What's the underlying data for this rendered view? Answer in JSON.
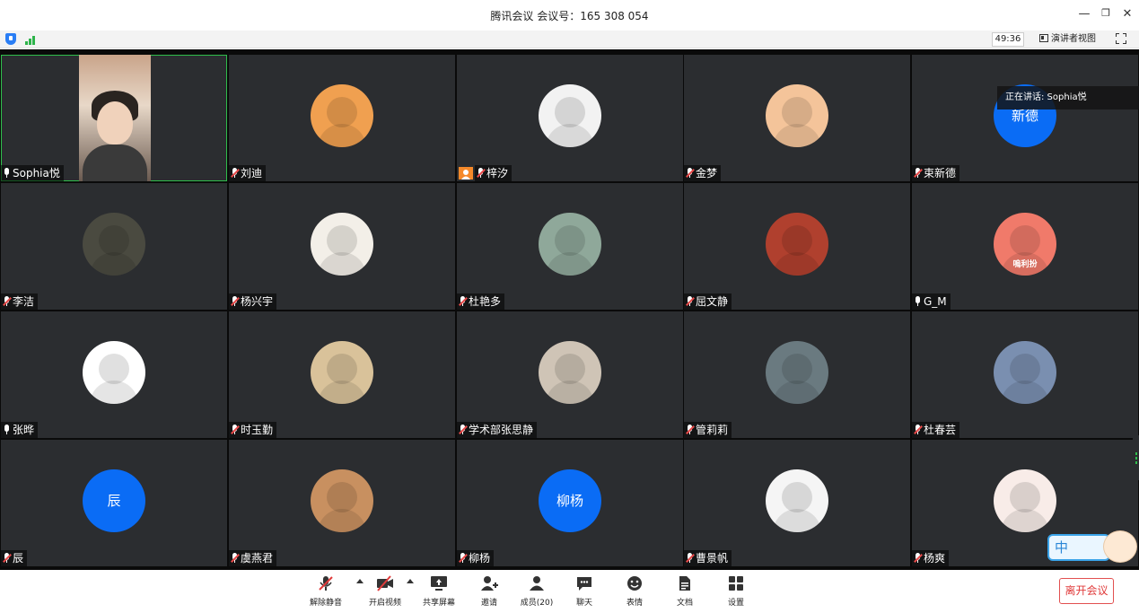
{
  "window": {
    "title": "腾讯会议 会议号：165 308 054",
    "minimize": "—",
    "restore": "❐",
    "close": "✕"
  },
  "status": {
    "timer": "49:36",
    "presenter_view": "演讲者视图"
  },
  "speaking_tip": "正在讲话: Sophia悦",
  "participants": [
    {
      "name": "Sophia悦",
      "muted": false,
      "type": "video"
    },
    {
      "name": "刘迪",
      "muted": true,
      "type": "avatar",
      "color": "#f0a050"
    },
    {
      "name": "梓汐",
      "muted": true,
      "type": "avatar",
      "color": "#f2f2f2",
      "host": true
    },
    {
      "name": "金梦",
      "muted": true,
      "type": "avatar",
      "color": "#f4c49a"
    },
    {
      "name": "束新德",
      "muted": true,
      "type": "initial",
      "initial": "新德",
      "color": "#0a6cf5"
    },
    {
      "name": "李洁",
      "muted": true,
      "type": "avatar",
      "color": "#4a4a40"
    },
    {
      "name": "杨兴宇",
      "muted": true,
      "type": "avatar",
      "color": "#f3efe8"
    },
    {
      "name": "杜艳多",
      "muted": true,
      "type": "avatar",
      "color": "#8fa89a"
    },
    {
      "name": "屈文静",
      "muted": true,
      "type": "avatar",
      "color": "#b0402e"
    },
    {
      "name": "G_M",
      "muted": false,
      "type": "avatar",
      "color": "#f07a6a",
      "caption": "嗚利扮"
    },
    {
      "name": "张晔",
      "muted": false,
      "type": "avatar",
      "color": "#ffffff"
    },
    {
      "name": "时玉勤",
      "muted": true,
      "type": "avatar",
      "color": "#d9c29a"
    },
    {
      "name": "学术部张思静",
      "muted": true,
      "type": "avatar",
      "color": "#cfc4b6"
    },
    {
      "name": "管莉莉",
      "muted": true,
      "type": "avatar",
      "color": "#6a7a80"
    },
    {
      "name": "杜春芸",
      "muted": true,
      "type": "avatar",
      "color": "#7a8fb0"
    },
    {
      "name": "辰",
      "muted": true,
      "type": "initial",
      "initial": "辰",
      "color": "#0a6cf5"
    },
    {
      "name": "虞燕君",
      "muted": true,
      "type": "avatar",
      "color": "#c89060"
    },
    {
      "name": "柳杨",
      "muted": true,
      "type": "initial",
      "initial": "柳杨",
      "color": "#0a6cf5"
    },
    {
      "name": "曹景帆",
      "muted": true,
      "type": "avatar",
      "color": "#f5f5f5"
    },
    {
      "name": "杨爽",
      "muted": true,
      "type": "avatar",
      "color": "#f8ece8"
    }
  ],
  "toolbar": {
    "unmute": "解除静音",
    "start_video": "开启视频",
    "share_screen": "共享屏幕",
    "invite": "邀请",
    "members": "成员(20)",
    "chat": "聊天",
    "emoji": "表情",
    "docs": "文档",
    "settings": "设置",
    "leave": "离开会议"
  },
  "ime": {
    "label": "中"
  }
}
